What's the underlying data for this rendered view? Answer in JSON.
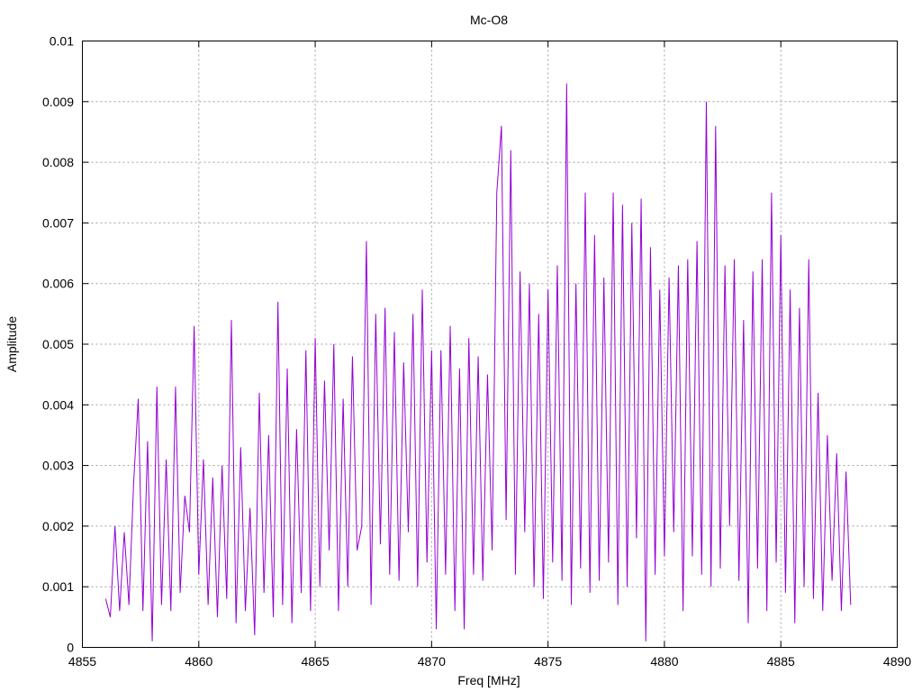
{
  "chart_data": {
    "type": "line",
    "title": "Mc-O8",
    "xlabel": "Freq [MHz]",
    "ylabel": "Amplitude",
    "xlim": [
      4855,
      4890
    ],
    "ylim": [
      0,
      0.01
    ],
    "xticks": [
      "4855",
      "4860",
      "4865",
      "4870",
      "4875",
      "4880",
      "4885",
      "4890"
    ],
    "yticks": [
      "0",
      "0.001",
      "0.002",
      "0.003",
      "0.004",
      "0.005",
      "0.006",
      "0.007",
      "0.008",
      "0.009",
      "0.01"
    ],
    "grid": true,
    "series_color": "#9400d3",
    "x_start": 4856,
    "x_step": 0.2,
    "values": [
      0.0008,
      0.0005,
      0.002,
      0.0006,
      0.0019,
      0.0007,
      0.0027,
      0.0041,
      0.0006,
      0.0034,
      0.0001,
      0.0043,
      0.0007,
      0.0031,
      0.0006,
      0.0043,
      0.0009,
      0.0025,
      0.0019,
      0.0053,
      0.0012,
      0.0031,
      0.0007,
      0.0028,
      0.0005,
      0.003,
      0.0008,
      0.0054,
      0.0004,
      0.0033,
      0.0006,
      0.0023,
      0.0002,
      0.0042,
      0.0009,
      0.0035,
      0.0005,
      0.0057,
      0.0007,
      0.0046,
      0.0004,
      0.0036,
      0.0009,
      0.0049,
      0.0006,
      0.0051,
      0.001,
      0.0044,
      0.0016,
      0.005,
      0.0006,
      0.0041,
      0.001,
      0.0048,
      0.0016,
      0.002,
      0.0067,
      0.0007,
      0.0055,
      0.0017,
      0.0056,
      0.0012,
      0.0052,
      0.0011,
      0.0047,
      0.0019,
      0.0055,
      0.001,
      0.0059,
      0.0014,
      0.0049,
      0.0003,
      0.0049,
      0.0012,
      0.0053,
      0.0006,
      0.0046,
      0.0003,
      0.0051,
      0.0012,
      0.0048,
      0.0011,
      0.0045,
      0.0016,
      0.0075,
      0.0086,
      0.0021,
      0.0082,
      0.0012,
      0.0062,
      0.0019,
      0.006,
      0.001,
      0.0055,
      0.0008,
      0.0059,
      0.0014,
      0.0063,
      0.0011,
      0.0093,
      0.0007,
      0.006,
      0.0013,
      0.0075,
      0.0009,
      0.0068,
      0.0011,
      0.0061,
      0.0014,
      0.0075,
      0.0007,
      0.0073,
      0.001,
      0.007,
      0.0018,
      0.0074,
      0.0001,
      0.0066,
      0.0012,
      0.0059,
      0.0015,
      0.0061,
      0.0019,
      0.0063,
      0.0006,
      0.0064,
      0.0015,
      0.0067,
      0.0012,
      0.009,
      0.001,
      0.0086,
      0.0013,
      0.0063,
      0.002,
      0.0064,
      0.0011,
      0.0054,
      0.0004,
      0.0062,
      0.0013,
      0.0064,
      0.0006,
      0.0075,
      0.0014,
      0.0068,
      0.0009,
      0.0059,
      0.0004,
      0.0056,
      0.001,
      0.0064,
      0.0008,
      0.0042,
      0.0006,
      0.0035,
      0.0011,
      0.0032,
      0.0006,
      0.0029,
      0.0007
    ]
  }
}
